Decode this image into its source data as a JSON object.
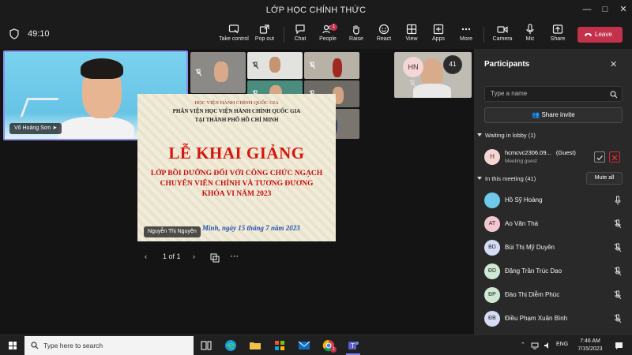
{
  "window": {
    "title": "LỚP HỌC CHÍNH THỨC"
  },
  "toolbar": {
    "timer": "49:10",
    "buttons": [
      {
        "label": "Take control",
        "icon": "take-control-icon"
      },
      {
        "label": "Pop out",
        "icon": "pop-out-icon"
      },
      {
        "label": "Chat",
        "icon": "chat-icon"
      },
      {
        "label": "People",
        "icon": "people-icon",
        "badge": "1"
      },
      {
        "label": "Raise",
        "icon": "raise-hand-icon"
      },
      {
        "label": "React",
        "icon": "react-icon"
      },
      {
        "label": "View",
        "icon": "view-icon"
      },
      {
        "label": "Apps",
        "icon": "apps-icon"
      },
      {
        "label": "More",
        "icon": "more-icon"
      },
      {
        "label": "Camera",
        "icon": "camera-icon"
      },
      {
        "label": "Mic",
        "icon": "mic-icon"
      },
      {
        "label": "Share",
        "icon": "share-icon"
      }
    ],
    "leave_label": "Leave"
  },
  "stage": {
    "main_speaker": "Võ Hoàng Sơn",
    "avatar_initials": "HN",
    "overflow_count": "41"
  },
  "slide": {
    "line1": "HỌC VIỆN HÀNH CHÍNH QUỐC GIA",
    "line2": "PHÂN VIỆN HỌC VIỆN HÀNH CHÍNH QUỐC GIA",
    "line3": "TẠI THÀNH PHỐ HỒ CHÍ MINH",
    "heading": "LỄ KHAI GIẢNG",
    "line5": "LỚP BỒI DƯỠNG ĐỐI VỚI CÔNG CHỨC NGẠCH",
    "line6": "CHUYÊN VIÊN CHÍNH VÀ TƯƠNG ĐƯƠNG",
    "line7": "KHÓA VI NĂM 2023",
    "date_line": "Minh, ngày 15 tháng 7 năm 2023",
    "presenter": "Nguyễn Thị Nguyện",
    "page_indicator": "1 of 1"
  },
  "participants": {
    "title": "Participants",
    "search_placeholder": "Type a name",
    "share_invite": "Share invite",
    "lobby_header": "Waiting in lobby (1)",
    "lobby": {
      "initial": "H",
      "name": "hcmcvc2306.09...",
      "tag": "(Guest)",
      "sub": "Meeting guest"
    },
    "meeting_header": "In this meeting (41)",
    "mute_all": "Mute all",
    "members": [
      {
        "name": "Hồ Sỹ Hoàng",
        "initials": "",
        "color": "#6fc9e9",
        "muted": false
      },
      {
        "name": "Ao Văn Thá",
        "initials": "AT",
        "color": "#f3c7cf",
        "muted": true
      },
      {
        "name": "Bùi Thị Mỹ Duyên",
        "initials": "BD",
        "color": "#d5dcf5",
        "muted": true
      },
      {
        "name": "Đặng Trần Trúc Dao",
        "initials": "ĐD",
        "color": "#cfe8d4",
        "muted": true
      },
      {
        "name": "Đào Thị Diễm Phúc",
        "initials": "ĐP",
        "color": "#cfe8d4",
        "muted": true
      },
      {
        "name": "Điều Phạm Xuân Bình",
        "initials": "ĐB",
        "color": "#d5dcf5",
        "muted": true
      }
    ]
  },
  "taskbar": {
    "search_placeholder": "Type here to search",
    "language": "ENG",
    "time": "7:46 AM",
    "date": "7/15/2023",
    "notification_count": "1"
  }
}
